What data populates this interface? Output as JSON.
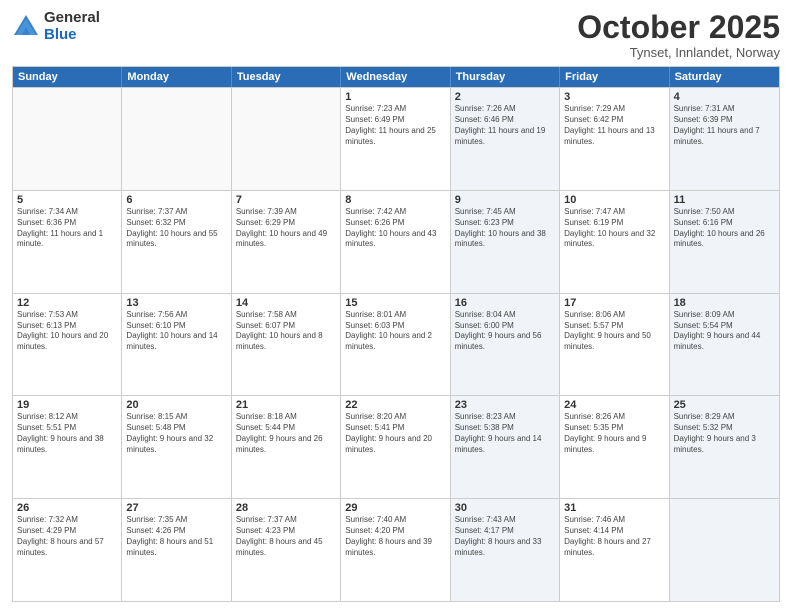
{
  "logo": {
    "general": "General",
    "blue": "Blue"
  },
  "header": {
    "month": "October 2025",
    "location": "Tynset, Innlandet, Norway"
  },
  "weekdays": [
    "Sunday",
    "Monday",
    "Tuesday",
    "Wednesday",
    "Thursday",
    "Friday",
    "Saturday"
  ],
  "rows": [
    [
      {
        "day": "",
        "sunrise": "",
        "sunset": "",
        "daylight": "",
        "shaded": false,
        "empty": true
      },
      {
        "day": "",
        "sunrise": "",
        "sunset": "",
        "daylight": "",
        "shaded": false,
        "empty": true
      },
      {
        "day": "",
        "sunrise": "",
        "sunset": "",
        "daylight": "",
        "shaded": false,
        "empty": true
      },
      {
        "day": "1",
        "sunrise": "Sunrise: 7:23 AM",
        "sunset": "Sunset: 6:49 PM",
        "daylight": "Daylight: 11 hours and 25 minutes.",
        "shaded": false,
        "empty": false
      },
      {
        "day": "2",
        "sunrise": "Sunrise: 7:26 AM",
        "sunset": "Sunset: 6:46 PM",
        "daylight": "Daylight: 11 hours and 19 minutes.",
        "shaded": true,
        "empty": false
      },
      {
        "day": "3",
        "sunrise": "Sunrise: 7:29 AM",
        "sunset": "Sunset: 6:42 PM",
        "daylight": "Daylight: 11 hours and 13 minutes.",
        "shaded": false,
        "empty": false
      },
      {
        "day": "4",
        "sunrise": "Sunrise: 7:31 AM",
        "sunset": "Sunset: 6:39 PM",
        "daylight": "Daylight: 11 hours and 7 minutes.",
        "shaded": true,
        "empty": false
      }
    ],
    [
      {
        "day": "5",
        "sunrise": "Sunrise: 7:34 AM",
        "sunset": "Sunset: 6:36 PM",
        "daylight": "Daylight: 11 hours and 1 minute.",
        "shaded": false,
        "empty": false
      },
      {
        "day": "6",
        "sunrise": "Sunrise: 7:37 AM",
        "sunset": "Sunset: 6:32 PM",
        "daylight": "Daylight: 10 hours and 55 minutes.",
        "shaded": false,
        "empty": false
      },
      {
        "day": "7",
        "sunrise": "Sunrise: 7:39 AM",
        "sunset": "Sunset: 6:29 PM",
        "daylight": "Daylight: 10 hours and 49 minutes.",
        "shaded": false,
        "empty": false
      },
      {
        "day": "8",
        "sunrise": "Sunrise: 7:42 AM",
        "sunset": "Sunset: 6:26 PM",
        "daylight": "Daylight: 10 hours and 43 minutes.",
        "shaded": false,
        "empty": false
      },
      {
        "day": "9",
        "sunrise": "Sunrise: 7:45 AM",
        "sunset": "Sunset: 6:23 PM",
        "daylight": "Daylight: 10 hours and 38 minutes.",
        "shaded": true,
        "empty": false
      },
      {
        "day": "10",
        "sunrise": "Sunrise: 7:47 AM",
        "sunset": "Sunset: 6:19 PM",
        "daylight": "Daylight: 10 hours and 32 minutes.",
        "shaded": false,
        "empty": false
      },
      {
        "day": "11",
        "sunrise": "Sunrise: 7:50 AM",
        "sunset": "Sunset: 6:16 PM",
        "daylight": "Daylight: 10 hours and 26 minutes.",
        "shaded": true,
        "empty": false
      }
    ],
    [
      {
        "day": "12",
        "sunrise": "Sunrise: 7:53 AM",
        "sunset": "Sunset: 6:13 PM",
        "daylight": "Daylight: 10 hours and 20 minutes.",
        "shaded": false,
        "empty": false
      },
      {
        "day": "13",
        "sunrise": "Sunrise: 7:56 AM",
        "sunset": "Sunset: 6:10 PM",
        "daylight": "Daylight: 10 hours and 14 minutes.",
        "shaded": false,
        "empty": false
      },
      {
        "day": "14",
        "sunrise": "Sunrise: 7:58 AM",
        "sunset": "Sunset: 6:07 PM",
        "daylight": "Daylight: 10 hours and 8 minutes.",
        "shaded": false,
        "empty": false
      },
      {
        "day": "15",
        "sunrise": "Sunrise: 8:01 AM",
        "sunset": "Sunset: 6:03 PM",
        "daylight": "Daylight: 10 hours and 2 minutes.",
        "shaded": false,
        "empty": false
      },
      {
        "day": "16",
        "sunrise": "Sunrise: 8:04 AM",
        "sunset": "Sunset: 6:00 PM",
        "daylight": "Daylight: 9 hours and 56 minutes.",
        "shaded": true,
        "empty": false
      },
      {
        "day": "17",
        "sunrise": "Sunrise: 8:06 AM",
        "sunset": "Sunset: 5:57 PM",
        "daylight": "Daylight: 9 hours and 50 minutes.",
        "shaded": false,
        "empty": false
      },
      {
        "day": "18",
        "sunrise": "Sunrise: 8:09 AM",
        "sunset": "Sunset: 5:54 PM",
        "daylight": "Daylight: 9 hours and 44 minutes.",
        "shaded": true,
        "empty": false
      }
    ],
    [
      {
        "day": "19",
        "sunrise": "Sunrise: 8:12 AM",
        "sunset": "Sunset: 5:51 PM",
        "daylight": "Daylight: 9 hours and 38 minutes.",
        "shaded": false,
        "empty": false
      },
      {
        "day": "20",
        "sunrise": "Sunrise: 8:15 AM",
        "sunset": "Sunset: 5:48 PM",
        "daylight": "Daylight: 9 hours and 32 minutes.",
        "shaded": false,
        "empty": false
      },
      {
        "day": "21",
        "sunrise": "Sunrise: 8:18 AM",
        "sunset": "Sunset: 5:44 PM",
        "daylight": "Daylight: 9 hours and 26 minutes.",
        "shaded": false,
        "empty": false
      },
      {
        "day": "22",
        "sunrise": "Sunrise: 8:20 AM",
        "sunset": "Sunset: 5:41 PM",
        "daylight": "Daylight: 9 hours and 20 minutes.",
        "shaded": false,
        "empty": false
      },
      {
        "day": "23",
        "sunrise": "Sunrise: 8:23 AM",
        "sunset": "Sunset: 5:38 PM",
        "daylight": "Daylight: 9 hours and 14 minutes.",
        "shaded": true,
        "empty": false
      },
      {
        "day": "24",
        "sunrise": "Sunrise: 8:26 AM",
        "sunset": "Sunset: 5:35 PM",
        "daylight": "Daylight: 9 hours and 9 minutes.",
        "shaded": false,
        "empty": false
      },
      {
        "day": "25",
        "sunrise": "Sunrise: 8:29 AM",
        "sunset": "Sunset: 5:32 PM",
        "daylight": "Daylight: 9 hours and 3 minutes.",
        "shaded": true,
        "empty": false
      }
    ],
    [
      {
        "day": "26",
        "sunrise": "Sunrise: 7:32 AM",
        "sunset": "Sunset: 4:29 PM",
        "daylight": "Daylight: 8 hours and 57 minutes.",
        "shaded": false,
        "empty": false
      },
      {
        "day": "27",
        "sunrise": "Sunrise: 7:35 AM",
        "sunset": "Sunset: 4:26 PM",
        "daylight": "Daylight: 8 hours and 51 minutes.",
        "shaded": false,
        "empty": false
      },
      {
        "day": "28",
        "sunrise": "Sunrise: 7:37 AM",
        "sunset": "Sunset: 4:23 PM",
        "daylight": "Daylight: 8 hours and 45 minutes.",
        "shaded": false,
        "empty": false
      },
      {
        "day": "29",
        "sunrise": "Sunrise: 7:40 AM",
        "sunset": "Sunset: 4:20 PM",
        "daylight": "Daylight: 8 hours and 39 minutes.",
        "shaded": false,
        "empty": false
      },
      {
        "day": "30",
        "sunrise": "Sunrise: 7:43 AM",
        "sunset": "Sunset: 4:17 PM",
        "daylight": "Daylight: 8 hours and 33 minutes.",
        "shaded": true,
        "empty": false
      },
      {
        "day": "31",
        "sunrise": "Sunrise: 7:46 AM",
        "sunset": "Sunset: 4:14 PM",
        "daylight": "Daylight: 8 hours and 27 minutes.",
        "shaded": false,
        "empty": false
      },
      {
        "day": "",
        "sunrise": "",
        "sunset": "",
        "daylight": "",
        "shaded": true,
        "empty": true
      }
    ]
  ]
}
